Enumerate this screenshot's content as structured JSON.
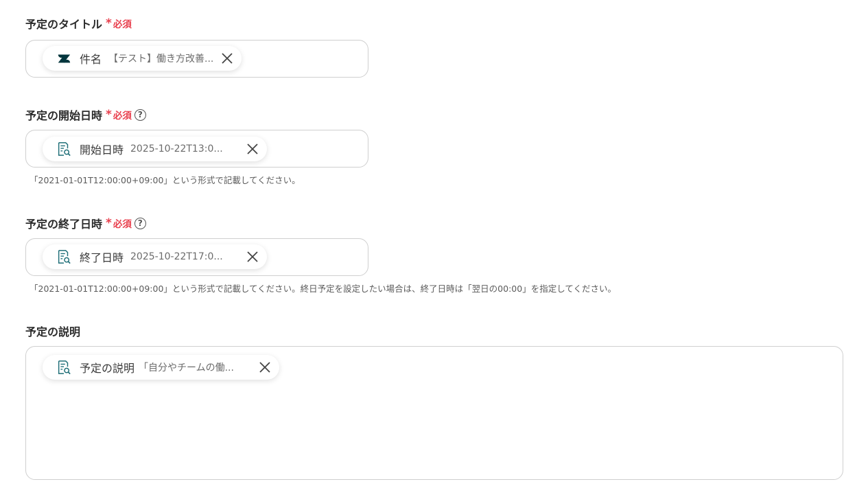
{
  "fields": [
    {
      "label": "予定のタイトル",
      "required_star": "*",
      "required_text": "必須",
      "chip": {
        "icon": "zendesk-icon",
        "name": "件名",
        "value": "【テスト】働き方改善..."
      }
    },
    {
      "label": "予定の開始日時",
      "required_star": "*",
      "required_text": "必須",
      "help": "?",
      "chip": {
        "icon": "document-search-icon",
        "name": "開始日時",
        "value": "2025-10-22T13:0..."
      },
      "hint": "「2021-01-01T12:00:00+09:00」という形式で記載してください。"
    },
    {
      "label": "予定の終了日時",
      "required_star": "*",
      "required_text": "必須",
      "help": "?",
      "chip": {
        "icon": "document-search-icon",
        "name": "終了日時",
        "value": "2025-10-22T17:0..."
      },
      "hint": "「2021-01-01T12:00:00+09:00」という形式で記載してください。終日予定を設定したい場合は、終了日時は「翌日の00:00」を指定してください。"
    },
    {
      "label": "予定の説明",
      "chip": {
        "icon": "document-search-icon",
        "name": "予定の説明",
        "value": "「自分やチームの働..."
      }
    }
  ],
  "colors": {
    "required": "#e8404e",
    "border": "#cfcfcf",
    "icon_teal": "#1f6f78",
    "zendesk": "#03363d"
  }
}
